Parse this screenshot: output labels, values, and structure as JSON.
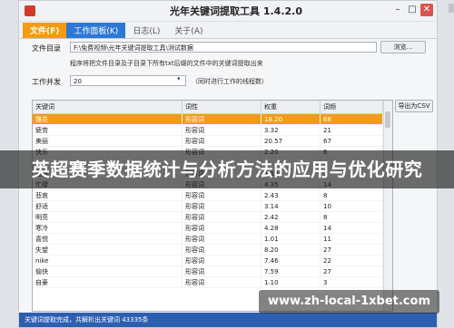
{
  "window": {
    "title": "光年关键词提取工具 1.4.2.0"
  },
  "tabs": [
    {
      "label": "文件(F)"
    },
    {
      "label": "工作面板(K)"
    },
    {
      "label": "日志(L)"
    },
    {
      "label": "关于(A)"
    }
  ],
  "form": {
    "dir_label": "文件目录",
    "dir_value": "F:\\免费视频\\光年关键词提取工具\\测试数据",
    "browse_label": "浏览...",
    "dir_hint": "程序将把文件目录及子目录下所有txt后缀的文件中的关键词提取出来",
    "threads_label": "工作并发",
    "threads_value": "20",
    "threads_hint": "（同时进行工作的线程数）",
    "export_label": "导出为CSV"
  },
  "table": {
    "headers": [
      "关键词",
      "词性",
      "权重",
      "词频"
    ],
    "rows": [
      [
        "雕花",
        "形容词",
        "18.20",
        "68"
      ],
      [
        "疲劳",
        "形容词",
        "3.32",
        "21"
      ],
      [
        "美丽",
        "形容词",
        "20.57",
        "67"
      ],
      [
        "快乐",
        "形容词",
        "2.20",
        "6"
      ],
      [
        "",
        "",
        "",
        ""
      ],
      [
        "难熬",
        "形容词",
        "1.10",
        "3"
      ],
      [
        "忙碌",
        "形容词",
        "4.35",
        "14"
      ],
      [
        "悲哀",
        "形容词",
        "2.43",
        "8"
      ],
      [
        "舒适",
        "形容词",
        "3.14",
        "10"
      ],
      [
        "明亮",
        "形容词",
        "2.42",
        "8"
      ],
      [
        "寒冷",
        "形容词",
        "4.28",
        "14"
      ],
      [
        "喜悦",
        "形容词",
        "1.01",
        "11"
      ],
      [
        "失望",
        "形容词",
        "8.20",
        "27"
      ],
      [
        "nike",
        "形容词",
        "7.46",
        "22"
      ],
      [
        "愉快",
        "形容词",
        "7.59",
        "27"
      ],
      [
        "自豪",
        "形容词",
        "1.10",
        "3"
      ]
    ]
  },
  "status": {
    "text": "关键词提取完成，共解析出关键词 43335条"
  },
  "overlay": {
    "banner": "英超赛季数据统计与分析方法的应用与优化研究",
    "watermark": "www.zh-local-1xbet.com"
  }
}
